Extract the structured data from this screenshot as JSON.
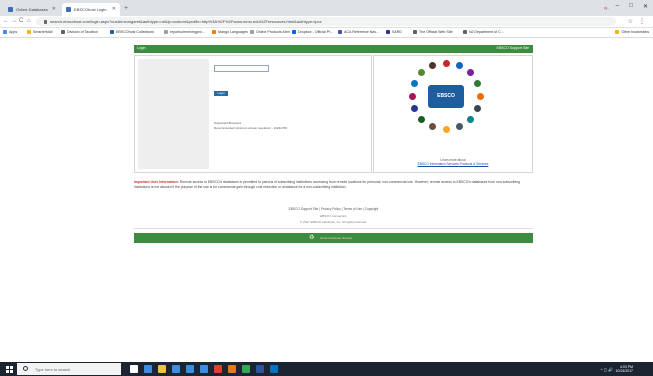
{
  "browser": {
    "tabs": [
      {
        "label": "Online Databases",
        "active": false
      },
      {
        "label": "EBSCOhost Login",
        "active": true
      }
    ],
    "new_tab_label": "+",
    "window_controls": {
      "minimize": "–",
      "maximize": "□",
      "close": "✕"
    },
    "profile_label": "cj.. ",
    "address": "search.ebscohost.com/login.aspx?custid=margaret&authtype=url&lp=custom&profile=http%3A%2F%2Fwww.mmu.edu%2Fresources.html&authtype=ipcz",
    "nav": {
      "back": "←",
      "forward": "→",
      "reload": "C",
      "home": "⌂"
    },
    "star": "☆",
    "menu": "⋮"
  },
  "bookmarks": {
    "items": [
      {
        "label": "Apps",
        "color": "#4285f4"
      },
      {
        "label": "SmarterMail",
        "color": "#f4b400"
      },
      {
        "label": "Division of Taxation",
        "color": "#5f6368"
      },
      {
        "label": "EBSCOhost Collections",
        "color": "#1f5e9e"
      },
      {
        "label": "reportcoleminingpro...",
        "color": "#9e9e9e"
      },
      {
        "label": "Mango Languages",
        "color": "#f57c00"
      },
      {
        "label": "Online Products Alert",
        "color": "#9e9e9e"
      },
      {
        "label": "Dropbox - Official Pr...",
        "color": "#0061fe"
      },
      {
        "label": "ACA Reference Nav...",
        "color": "#3f51b5"
      },
      {
        "label": "SARD",
        "color": "#283593"
      },
      {
        "label": "The Official Web Site",
        "color": "#5f6368"
      },
      {
        "label": "NJ Department of C...",
        "color": "#5f6368"
      }
    ],
    "other": "Other bookmarks"
  },
  "page": {
    "header_left": "Login",
    "header_right": "EBSCO Support Site",
    "login_button": "Login",
    "supported_browsers_title": "Supported Browsers",
    "supported_browsers_text": "Recommended minimum screen resolution - 1024x768",
    "ebsco_center_label": "EBSCO",
    "promo_caption": "Learn more about",
    "promo_link": "EBSCO Information Services Products & Services",
    "notice_title": "Important User Information:",
    "notice_body": "Remote access to EBSCO's databases is permitted to patrons of subscribing institutions accessing from remote locations for personal, non-commercial use. However, remote access to EBSCO's databases from non-subscribing institutions is not allowed if the purpose of the use is for commercial gain through cost reduction or avoidance for a non-subscribing institution.",
    "footer_links": [
      "EBSCO Support Site",
      "Privacy Policy",
      "Terms of Use",
      "Copyright"
    ],
    "footer_line2": "EBSCO Connection",
    "footer_line3": "© 2017 EBSCO Industries, Inc. All rights reserved.",
    "bottom_logo": "♻",
    "bottom_text": "Great Customer Service"
  },
  "taskbar": {
    "search_placeholder": "Type here to search",
    "time": "4:03 PM",
    "date": "10/24/2017",
    "tray": "^ ◻ 🔊",
    "apps": [
      {
        "name": "task-view",
        "color": "#ffffff"
      },
      {
        "name": "edge",
        "color": "#3c8fe0"
      },
      {
        "name": "file-explorer",
        "color": "#f0c040"
      },
      {
        "name": "store",
        "color": "#3c8fe0"
      },
      {
        "name": "mail",
        "color": "#3c8fe0"
      },
      {
        "name": "calendar",
        "color": "#3c8fe0"
      },
      {
        "name": "chrome",
        "color": "#e04030"
      },
      {
        "name": "firefox",
        "color": "#e07a20"
      },
      {
        "name": "chrome-active",
        "color": "#34a853"
      },
      {
        "name": "word",
        "color": "#2b579a"
      },
      {
        "name": "outlook",
        "color": "#0072c6"
      }
    ]
  }
}
